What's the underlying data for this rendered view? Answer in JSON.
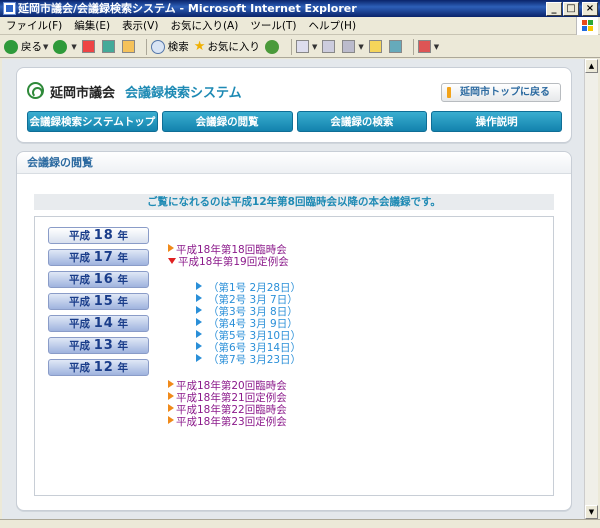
{
  "window": {
    "title": "延岡市議会/会議録検索システム - Microsoft Internet Explorer",
    "buttons": [
      "_",
      "□",
      "×"
    ]
  },
  "menu": [
    "ファイル(F)",
    "編集(E)",
    "表示(V)",
    "お気に入り(A)",
    "ツール(T)",
    "ヘルプ(H)"
  ],
  "toolbar": {
    "back_label": "戻る",
    "search_label": "検索",
    "favorites_label": "お気に入り"
  },
  "site": {
    "name": "延岡市議会",
    "system": "会議録検索システム",
    "top_link": "延岡市トップに戻る"
  },
  "nav": [
    "会議録検索システムトップ",
    "会議録の閲覧",
    "会議録の検索",
    "操作説明"
  ],
  "section_title": "会議録の閲覧",
  "notice": "ご覧になれるのは平成12年第8回臨時会以降の本会議録です。",
  "years": [
    {
      "prefix": "平成",
      "num": "18",
      "suffix": "年"
    },
    {
      "prefix": "平成",
      "num": "17",
      "suffix": "年"
    },
    {
      "prefix": "平成",
      "num": "16",
      "suffix": "年"
    },
    {
      "prefix": "平成",
      "num": "15",
      "suffix": "年"
    },
    {
      "prefix": "平成",
      "num": "14",
      "suffix": "年"
    },
    {
      "prefix": "平成",
      "num": "13",
      "suffix": "年"
    },
    {
      "prefix": "平成",
      "num": "12",
      "suffix": "年"
    }
  ],
  "sessions_top": [
    "平成18年第18回臨時会",
    "平成18年第19回定例会"
  ],
  "sub_items": [
    "（第1号  2月28日）",
    "（第2号  3月  7日）",
    "（第3号  3月  8日）",
    "（第4号  3月  9日）",
    "（第5号  3月10日）",
    "（第6号  3月14日）",
    "（第7号  3月23日）"
  ],
  "sessions_bottom": [
    "平成18年第20回臨時会",
    "平成18年第21回定例会",
    "平成18年第22回臨時会",
    "平成18年第23回定例会"
  ]
}
